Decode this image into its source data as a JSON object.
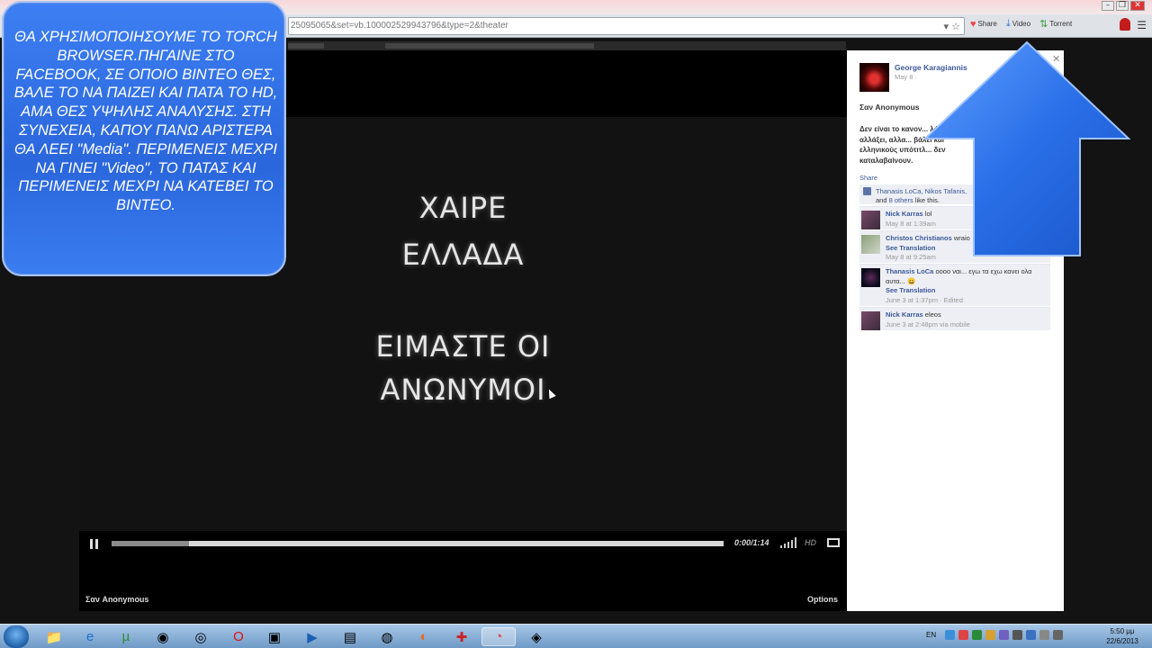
{
  "browser": {
    "address_url": "25095065&set=vb.100002529943796&type=2&theater",
    "toolbar": {
      "share_label": "Share",
      "video_label": "Video",
      "torrent_label": "Torrent"
    }
  },
  "callout": {
    "text": "ΘΑ ΧΡΗΣΙΜΟΠΟΙΗΣΟΥΜΕ ΤΟ TORCH BROWSER.ΠΗΓΑΙΝΕ ΣΤΟ FACEBOOK, ΣΕ ΟΠΟΙΟ ΒΙΝΤΕΟ ΘΕΣ, ΒΑΛΕ ΤΟ ΝΑ ΠΑΙΖΕΙ ΚΑΙ ΠΑΤΑ ΤΟ HD, ΑΜΑ ΘΕΣ ΥΨΗΛΗΣ ΑΝΑΛΥΣΗΣ. ΣΤΗ ΣΥΝΕΧΕΙΑ, ΚΑΠΟΥ ΠΑΝΩ ΑΡΙΣΤΕΡΑ ΘΑ ΛΕΕΙ \"Media\". ΠΕΡΙΜΕΝΕΙΣ ΜΕΧΡΙ ΝΑ ΓΙΝΕΙ \"Video\", ΤΟ ΠΑΤΑΣ ΚΑΙ ΠΕΡΙΜΕΝΕΙΣ ΜΕΧΡΙ ΝΑ ΚΑΤΕΒΕΙ ΤΟ ΒΙΝΤΕΟ."
  },
  "video": {
    "line1": "ΧΑΙΡΕ",
    "line2": "ΕΛΛΑΔΑ",
    "line3": "ΕΙΜΑΣΤΕ ΟΙ",
    "line4": "ΑΝΩΝΥΜΟΙ",
    "time": "0:00/1:14",
    "hd_label": "HD",
    "buffered_fraction": 0.126,
    "footer_title": "Σαν Anonymous",
    "options_label": "Options"
  },
  "post": {
    "author": "George Karagiannis",
    "date": "May 8 ·",
    "title": "Σαν Anonymous",
    "body": "Δεν είναι το κανον... λόγια, τα έχω αλλάξει, αλλα... βάλει και ελληνικούς υπότιτλ... δεν καταλαβαίνουν.",
    "share_label": "Share",
    "likes_names": "Thanasis LoCa, Nikos Tafanis,",
    "likes_and": "and",
    "likes_others": "8 others",
    "likes_suffix": "like this.",
    "comments": [
      {
        "name": "Nick Karras",
        "text": "lol",
        "extra": "",
        "meta": "May 8 at 1:39am"
      },
      {
        "name": "Christos Christianos",
        "text": "wraio",
        "extra": "See Translation",
        "meta": "May 8 at 9:25am"
      },
      {
        "name": "Thanasis LoCa",
        "text": "οοοο ναι... εγω τα εχω κανει ολα αυτα... 😀",
        "extra": "See Translation",
        "meta": "June 3 at 1:37pm · Edited"
      },
      {
        "name": "Nick Karras",
        "text": "eleos",
        "extra": "",
        "meta": "June 3 at 2:48pm via mobile"
      }
    ]
  },
  "taskbar": {
    "language": "EN",
    "time": "5:50 μμ",
    "date": "22/6/2013"
  },
  "colors": {
    "callout_blue": "#2f6fe6",
    "facebook_link": "#3b5998",
    "arrow_blue": "#1f63e0"
  }
}
